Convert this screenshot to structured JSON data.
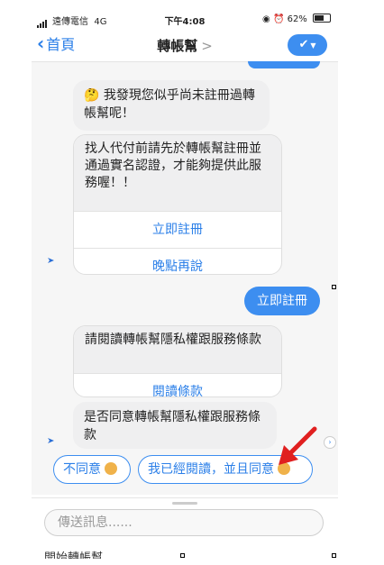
{
  "status_bar": {
    "carrier": "遠傳電信",
    "network": "4G",
    "time": "下午4:08",
    "battery": "62%",
    "battery_level": 0.62
  },
  "nav": {
    "back_label": "首頁",
    "title": "轉帳幫",
    "title_arrow": ">",
    "check_icon": "check-icon"
  },
  "messages": {
    "m1": "🤔 我發現您似乎尚未註冊過轉帳幫呢！",
    "m2_text": "找人代付前請先於轉帳幫註冊並通過實名認證，才能夠提供此服務喔！！",
    "m2_button1": "立即註冊",
    "m2_button2": "晚點再說",
    "user_reply": "立即註冊",
    "m3_text": "請閱讀轉帳幫隱私權跟服務條款",
    "m3_button": "閱讀條款",
    "m4_text": "是否同意轉帳幫隱私權跟服務條款"
  },
  "quick_replies": {
    "disagree": "不同意",
    "agree": "我已經閱讀，並且同意"
  },
  "composer": {
    "placeholder": "傳送訊息......"
  },
  "footer": {
    "label": "開始轉帳幫"
  },
  "colors": {
    "accent": "#3d8ef0",
    "link": "#2b7fe8",
    "bubble": "#efeff0",
    "arrow": "#e02020"
  }
}
